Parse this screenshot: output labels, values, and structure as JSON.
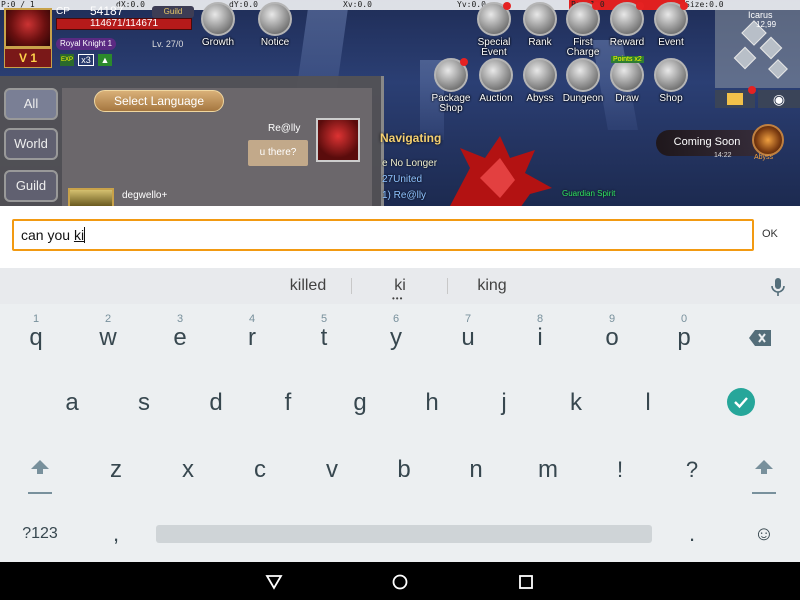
{
  "debug_bar": {
    "p": "P:0 / 1",
    "dx": "dX:0.0",
    "dy": "dY:0.0",
    "xv": "Xv:0.0",
    "yv": "Yv:0.0",
    "prs": "Prs:1.0",
    "size": "Size:0.0"
  },
  "player": {
    "cp_label": "CP",
    "cp_value": "54187",
    "guild_label": "Guild",
    "hp_text": "114671/114671",
    "rank": "Royal Knight 1",
    "level": "Lv. 27/0",
    "vip": "V 1",
    "exp_label": "EXP",
    "multiplier": "x3"
  },
  "top_menu": [
    {
      "label": "Growth",
      "icon": "growth-icon"
    },
    {
      "label": "Notice",
      "icon": "notice-icon"
    },
    {
      "label": "Special\nEvent",
      "icon": "special-event-icon"
    },
    {
      "label": "Rank",
      "icon": "rank-icon"
    },
    {
      "label": "First\nCharge",
      "icon": "first-charge-icon"
    },
    {
      "label": "Reward",
      "icon": "reward-icon"
    },
    {
      "label": "Event",
      "icon": "event-icon"
    }
  ],
  "second_menu": [
    {
      "label": "Package\nShop",
      "icon": "package-shop-icon"
    },
    {
      "label": "Auction",
      "icon": "auction-icon"
    },
    {
      "label": "Abyss",
      "icon": "abyss-icon"
    },
    {
      "label": "Dungeon",
      "icon": "dungeon-icon"
    },
    {
      "label": "Draw",
      "icon": "draw-icon",
      "badge": "Points x2"
    },
    {
      "label": "Shop",
      "icon": "shop-icon"
    }
  ],
  "minimap": {
    "name": "Icarus",
    "coords": "12,99"
  },
  "chat": {
    "tabs": [
      "All",
      "World",
      "Guild"
    ],
    "select_language": "Select Language",
    "messages": [
      {
        "name": "Re@lly",
        "text": "u there?"
      },
      {
        "name": "degwello+",
        "text": ""
      }
    ]
  },
  "game_overlay": {
    "navigating": "Navigating",
    "line1": "e No Longer",
    "line2": "27United",
    "line3": "1) Re@lly",
    "guardian": "Guardian Spirit",
    "coming_soon": "Coming Soon",
    "coming_soon_sub": "14:22",
    "abyss": "Abyss"
  },
  "ime": {
    "text_prefix": "can you ",
    "composing": "ki",
    "ok_label": "OK"
  },
  "keyboard": {
    "suggestions": [
      "killed",
      "ki",
      "king"
    ],
    "row1": [
      {
        "k": "q",
        "h": "1"
      },
      {
        "k": "w",
        "h": "2"
      },
      {
        "k": "e",
        "h": "3"
      },
      {
        "k": "r",
        "h": "4"
      },
      {
        "k": "t",
        "h": "5"
      },
      {
        "k": "y",
        "h": "6"
      },
      {
        "k": "u",
        "h": "7"
      },
      {
        "k": "i",
        "h": "8"
      },
      {
        "k": "o",
        "h": "9"
      },
      {
        "k": "p",
        "h": "0"
      }
    ],
    "row2": [
      "a",
      "s",
      "d",
      "f",
      "g",
      "h",
      "j",
      "k",
      "l"
    ],
    "row3": [
      "z",
      "x",
      "c",
      "v",
      "b",
      "n",
      "m",
      "!",
      "?"
    ],
    "symbols_label": "?123",
    "comma": ",",
    "period": ".",
    "emoji": "☺"
  },
  "colors": {
    "input_border": "#f29a12",
    "done_key": "#26a69a",
    "keyboard_bg": "#eceff1"
  }
}
